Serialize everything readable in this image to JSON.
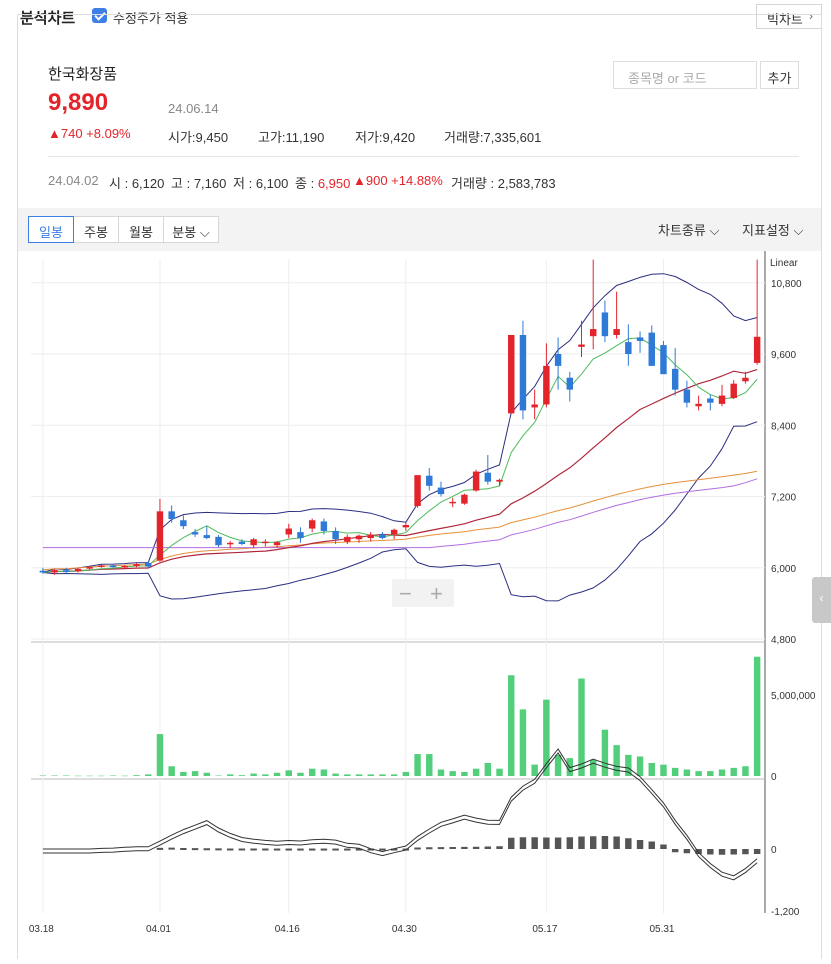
{
  "topbar": {
    "title": "분석차트",
    "adjusted_price_label": "수정주가 적용",
    "adjusted_price_checked": true,
    "big_chart_label": "빅차트",
    "big_chart_icon": "chevron-right-icon"
  },
  "stock": {
    "name": "한국화장품",
    "price": "9,890",
    "date": "24.06.14",
    "change": "▲740 +8.09%",
    "open_label": "시가",
    "open": "9,450",
    "high_label": "고가",
    "high": "11,190",
    "low_label": "저가",
    "low": "9,420",
    "volume_label": "거래량",
    "volume": "7,335,601"
  },
  "search": {
    "placeholder": "종목명 or 코드",
    "add_label": "추가"
  },
  "comparison": {
    "date": "24.04.02",
    "open_label": "시",
    "open": "6,120",
    "high_label": "고",
    "high": "7,160",
    "low_label": "저",
    "low": "6,100",
    "close_label": "종",
    "close": "6,950",
    "change": "▲900 +14.88%",
    "volume_label": "거래량",
    "volume": "2,583,783"
  },
  "toolbar": {
    "tabs": [
      "일봉",
      "주봉",
      "월봉",
      "분봉"
    ],
    "active_tab": "일봉",
    "chart_type_label": "차트종류",
    "indicator_label": "지표설정"
  },
  "colors": {
    "up": "#e3242b",
    "down": "#2f7ad6",
    "volume": "#53cf7c",
    "macd_hist": "#555555"
  },
  "chart_data": {
    "type": "candlestick",
    "scale_label": "Linear",
    "price_ticks": [
      "10,800",
      "9,600",
      "8,400",
      "7,200",
      "6,000",
      "4,800"
    ],
    "volume_ticks": [
      "5,000,000",
      "0"
    ],
    "macd_ticks": [
      "0",
      "-1,200"
    ],
    "x_ticks": [
      "03.18",
      "04.01",
      "04.16",
      "04.30",
      "05.17",
      "05.31"
    ],
    "candles": [
      [
        5950,
        6000,
        5900,
        5920
      ],
      [
        5920,
        5980,
        5880,
        5960
      ],
      [
        5960,
        6000,
        5900,
        5930
      ],
      [
        5940,
        6000,
        5920,
        5980
      ],
      [
        5990,
        6030,
        5960,
        6010
      ],
      [
        6020,
        6060,
        6000,
        6040
      ],
      [
        6040,
        6050,
        6000,
        6010
      ],
      [
        6010,
        6040,
        5990,
        6030
      ],
      [
        6030,
        6080,
        6010,
        6060
      ],
      [
        6080,
        6100,
        6000,
        6020
      ],
      [
        6120,
        7160,
        6100,
        6950
      ],
      [
        6950,
        7050,
        6760,
        6820
      ],
      [
        6800,
        6880,
        6650,
        6700
      ],
      [
        6600,
        6650,
        6520,
        6560
      ],
      [
        6550,
        6700,
        6480,
        6500
      ],
      [
        6520,
        6550,
        6350,
        6380
      ],
      [
        6400,
        6450,
        6330,
        6420
      ],
      [
        6440,
        6480,
        6380,
        6400
      ],
      [
        6380,
        6500,
        6330,
        6480
      ],
      [
        6420,
        6480,
        6360,
        6440
      ],
      [
        6380,
        6450,
        6340,
        6430
      ],
      [
        6560,
        6740,
        6500,
        6660
      ],
      [
        6600,
        6680,
        6420,
        6500
      ],
      [
        6660,
        6830,
        6600,
        6800
      ],
      [
        6780,
        6830,
        6560,
        6620
      ],
      [
        6620,
        6680,
        6400,
        6480
      ],
      [
        6440,
        6560,
        6400,
        6520
      ],
      [
        6480,
        6560,
        6420,
        6540
      ],
      [
        6500,
        6600,
        6440,
        6560
      ],
      [
        6560,
        6600,
        6480,
        6500
      ],
      [
        6560,
        6660,
        6480,
        6640
      ],
      [
        6680,
        6760,
        6620,
        6720
      ],
      [
        7040,
        7520,
        7010,
        7560
      ],
      [
        7550,
        7680,
        7300,
        7380
      ],
      [
        7350,
        7450,
        7200,
        7240
      ],
      [
        7100,
        7180,
        7020,
        7110
      ],
      [
        7080,
        7250,
        7060,
        7230
      ],
      [
        7300,
        7650,
        7280,
        7620
      ],
      [
        7600,
        7900,
        7400,
        7450
      ],
      [
        7450,
        7500,
        7380,
        7480
      ],
      [
        8600,
        9920,
        8600,
        9920
      ],
      [
        9920,
        10160,
        8500,
        8650
      ],
      [
        8700,
        9000,
        8500,
        8750
      ],
      [
        8750,
        9780,
        8700,
        9400
      ],
      [
        9600,
        9880,
        9000,
        9400
      ],
      [
        9200,
        9300,
        8800,
        9000
      ],
      [
        9720,
        10160,
        9550,
        9760
      ],
      [
        9900,
        11190,
        9680,
        10020
      ],
      [
        10300,
        10500,
        9800,
        9900
      ],
      [
        9920,
        10650,
        9860,
        10020
      ],
      [
        9800,
        10100,
        9400,
        9600
      ],
      [
        9880,
        9980,
        9620,
        9820
      ],
      [
        9960,
        10080,
        9600,
        9400
      ],
      [
        9750,
        9820,
        9400,
        9260
      ],
      [
        9350,
        9700,
        8900,
        9000
      ],
      [
        9000,
        9150,
        8700,
        8780
      ],
      [
        8720,
        8900,
        8650,
        8760
      ],
      [
        8850,
        8920,
        8650,
        8780
      ],
      [
        8760,
        9080,
        8720,
        8900
      ],
      [
        8860,
        9160,
        8840,
        9100
      ],
      [
        9140,
        9300,
        9100,
        9200
      ],
      [
        9450,
        11190,
        9420,
        9890
      ]
    ],
    "volume": [
      0.03,
      0.03,
      0.03,
      0.02,
      0.02,
      0.02,
      0.03,
      0.02,
      0.05,
      0.1,
      2.58,
      0.6,
      0.25,
      0.3,
      0.2,
      0.03,
      0.1,
      0.05,
      0.15,
      0.1,
      0.2,
      0.35,
      0.2,
      0.45,
      0.4,
      0.15,
      0.1,
      0.1,
      0.1,
      0.1,
      0.1,
      0.25,
      1.35,
      1.35,
      0.4,
      0.3,
      0.25,
      0.45,
      0.8,
      0.45,
      6.2,
      4.1,
      0.7,
      4.7,
      1.3,
      1.1,
      6.0,
      1.0,
      2.85,
      1.9,
      1.3,
      1.2,
      0.8,
      0.7,
      0.5,
      0.4,
      0.3,
      0.3,
      0.4,
      0.5,
      0.6,
      7.34
    ],
    "macd": {
      "zero_label": "0",
      "hist": [
        0,
        0,
        0,
        0,
        0,
        0,
        0,
        0,
        0,
        0,
        45,
        55,
        40,
        35,
        30,
        25,
        20,
        20,
        20,
        20,
        18,
        18,
        18,
        18,
        18,
        18,
        18,
        18,
        18,
        18,
        18,
        18,
        60,
        70,
        75,
        80,
        85,
        90,
        100,
        110,
        450,
        470,
        470,
        460,
        460,
        470,
        500,
        510,
        520,
        500,
        430,
        360,
        300,
        180,
        -130,
        -170,
        -200,
        -220,
        -230,
        -220,
        -210,
        -200
      ]
    }
  }
}
